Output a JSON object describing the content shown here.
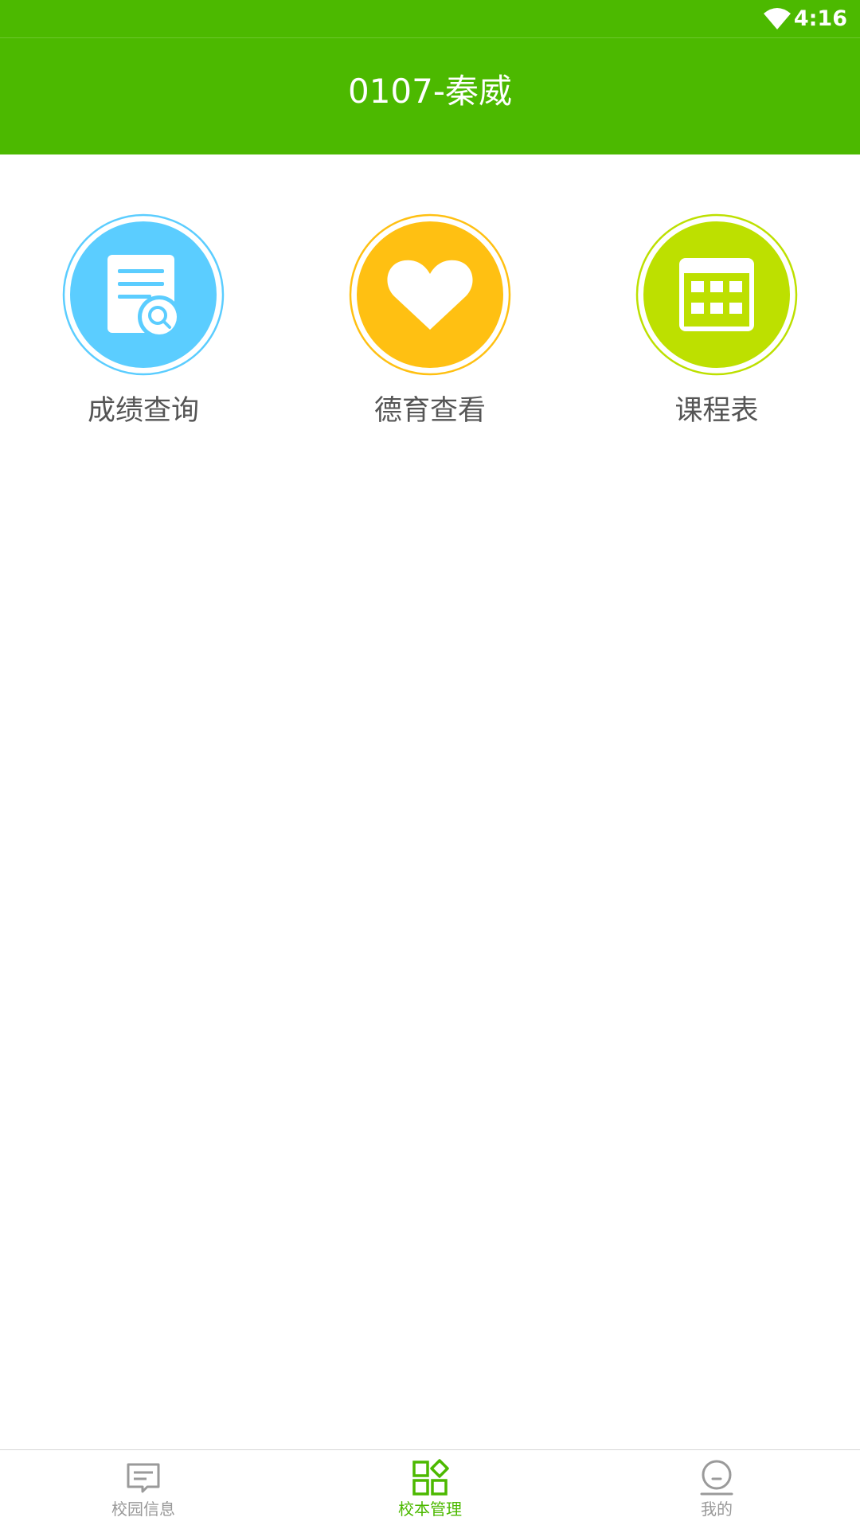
{
  "status_bar": {
    "time": "4:16",
    "wifi_icon": "wifi-icon"
  },
  "header": {
    "title": "0107-秦威"
  },
  "colors": {
    "primary_green": "#4cb900",
    "score_blue": "#5bcdff",
    "moral_yellow": "#ffc012",
    "schedule_lime": "#bde000",
    "nav_inactive": "#999999"
  },
  "grid": {
    "items": [
      {
        "label": "成绩查询",
        "icon": "document-search-icon"
      },
      {
        "label": "德育查看",
        "icon": "heart-icon"
      },
      {
        "label": "课程表",
        "icon": "calendar-grid-icon"
      }
    ]
  },
  "bottom_nav": {
    "items": [
      {
        "label": "校园信息",
        "icon": "message-icon",
        "active": false
      },
      {
        "label": "校本管理",
        "icon": "apps-icon",
        "active": true
      },
      {
        "label": "我的",
        "icon": "profile-icon",
        "active": false
      }
    ]
  }
}
